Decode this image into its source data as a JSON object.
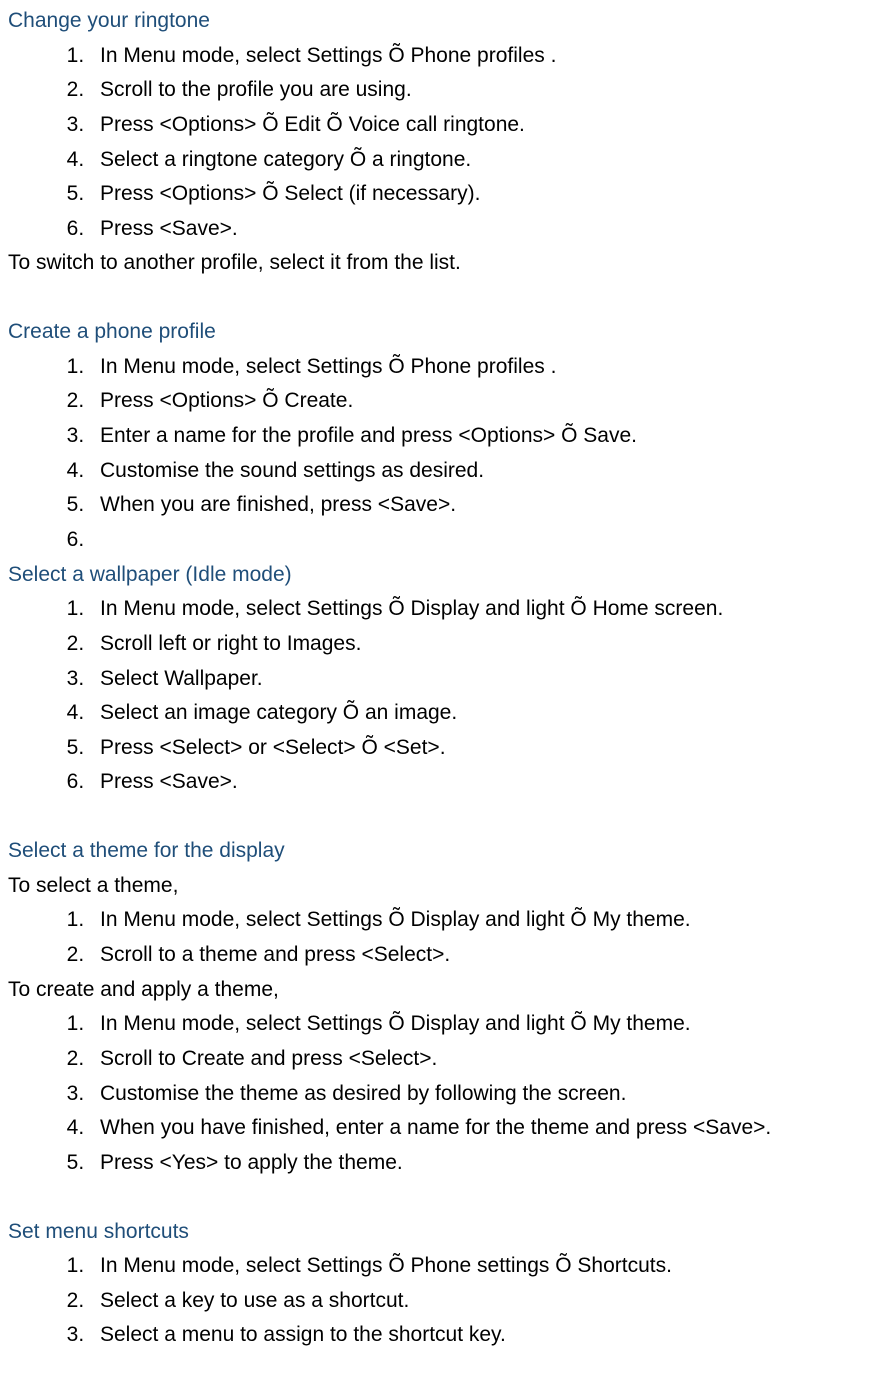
{
  "sections": [
    {
      "heading": "Change your ringtone",
      "items": [
        "In Menu mode, select Settings Õ Phone profiles .",
        "Scroll to the profile you are using.",
        "Press <Options> Õ Edit Õ Voice call ringtone.",
        "Select a ringtone category Õ a ringtone.",
        "Press <Options> Õ Select (if necessary).",
        "Press <Save>."
      ],
      "trailing": "To switch to another profile, select it from the list."
    },
    {
      "heading": "Create a phone profile",
      "items": [
        "In Menu mode, select Settings Õ Phone profiles .",
        "Press <Options> Õ Create.",
        "Enter a name for the profile and press <Options> Õ Save.",
        "Customise the sound settings as desired.",
        "When you are finished, press <Save>.",
        ""
      ]
    },
    {
      "heading": "Select a wallpaper (Idle mode)",
      "items": [
        "In Menu mode, select Settings Õ Display and light Õ Home screen.",
        "Scroll left or right to Images.",
        "Select Wallpaper.",
        "Select an image category Õ an image.",
        "Press <Select> or <Select> Õ <Set>.",
        "Press <Save>."
      ]
    },
    {
      "heading": "Select a theme for the display",
      "intro1": "To select a theme,",
      "list1": [
        "In Menu mode, select Settings Õ Display and light Õ My theme.",
        "Scroll to a theme and press <Select>."
      ],
      "intro2": "To create and apply a theme,",
      "list2": [
        "In Menu mode, select Settings Õ Display and light Õ My theme.",
        "Scroll to Create and press <Select>.",
        "Customise the theme as desired by following the screen.",
        "When you have finished, enter a name for the theme and press <Save>.",
        "Press <Yes> to apply the theme."
      ]
    },
    {
      "heading": "Set menu shortcuts",
      "items": [
        "In Menu mode, select Settings Õ Phone settings Õ Shortcuts.",
        "Select a key to use as a shortcut.",
        "Select a menu to assign to the shortcut key."
      ]
    }
  ]
}
